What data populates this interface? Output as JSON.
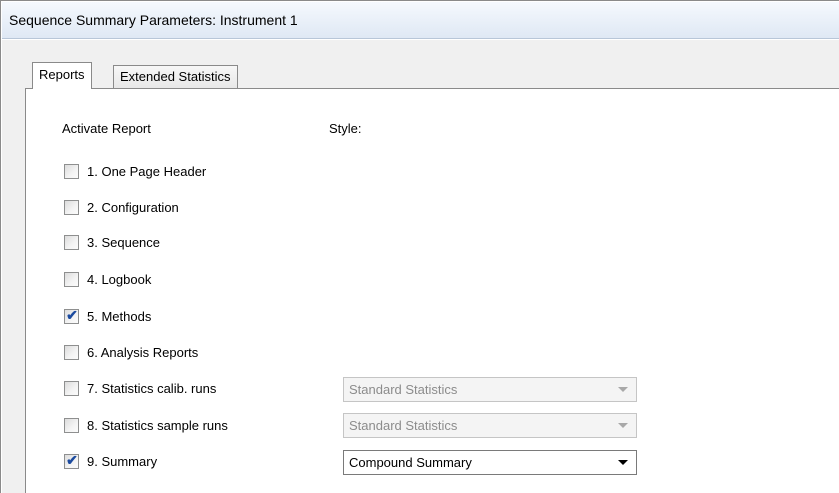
{
  "window": {
    "title": "Sequence Summary Parameters: Instrument 1"
  },
  "tabs": [
    {
      "label": "Reports",
      "selected": true
    },
    {
      "label": "Extended Statistics",
      "selected": false
    }
  ],
  "headers": {
    "activate_report": "Activate Report",
    "style": "Style:"
  },
  "reports": [
    {
      "label": "1. One Page Header",
      "checked": false
    },
    {
      "label": "2. Configuration",
      "checked": false
    },
    {
      "label": "3. Sequence",
      "checked": false
    },
    {
      "label": "4. Logbook",
      "checked": false
    },
    {
      "label": "5. Methods",
      "checked": true
    },
    {
      "label": "6. Analysis Reports",
      "checked": false
    },
    {
      "label": "7. Statistics calib. runs",
      "checked": false,
      "style": "Standard Statistics",
      "style_enabled": false
    },
    {
      "label": "8. Statistics sample runs",
      "checked": false,
      "style": "Standard Statistics",
      "style_enabled": false
    },
    {
      "label": "9. Summary",
      "checked": true,
      "style": "Compound Summary",
      "style_enabled": true
    }
  ],
  "icons": {
    "checkmark": "check-icon",
    "dropdown": "chevron-down-icon"
  },
  "colors": {
    "title_bar": "#dfe8f4",
    "checkmark": "#1c4b9f",
    "disabled_text": "#8c8c8c"
  }
}
